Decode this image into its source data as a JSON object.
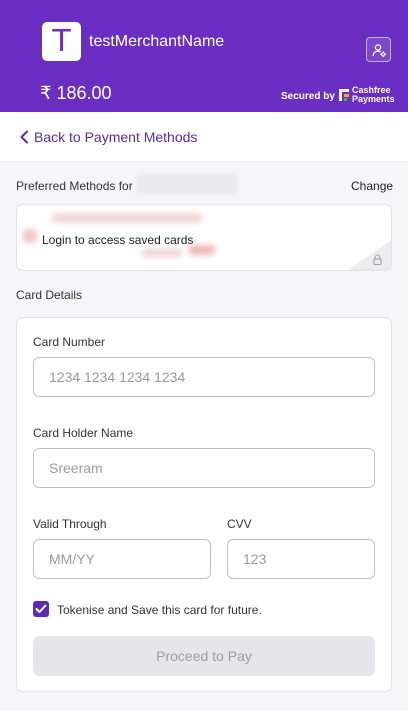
{
  "header": {
    "logo_letter": "T",
    "merchant_name": "testMerchantName",
    "amount": "₹ 186.00",
    "secured_by": "Secured by",
    "brand_line1": "Cashfree",
    "brand_line2": "Payments",
    "brand_color": "#6a2fc2"
  },
  "nav": {
    "back_label": "Back to Payment Methods"
  },
  "preferred": {
    "label": "Preferred Methods for",
    "change_label": "Change",
    "login_text": "Login to access saved cards"
  },
  "card_details": {
    "section_label": "Card Details",
    "card_number": {
      "label": "Card Number",
      "placeholder": "1234 1234 1234 1234"
    },
    "holder_name": {
      "label": "Card Holder Name",
      "placeholder": "Sreeram"
    },
    "valid_through": {
      "label": "Valid Through",
      "placeholder": "MM/YY"
    },
    "cvv": {
      "label": "CVV",
      "placeholder": "123"
    },
    "tokenise_label": "Tokenise and Save this card for future.",
    "tokenise_checked": true,
    "proceed_label": "Proceed to Pay"
  }
}
